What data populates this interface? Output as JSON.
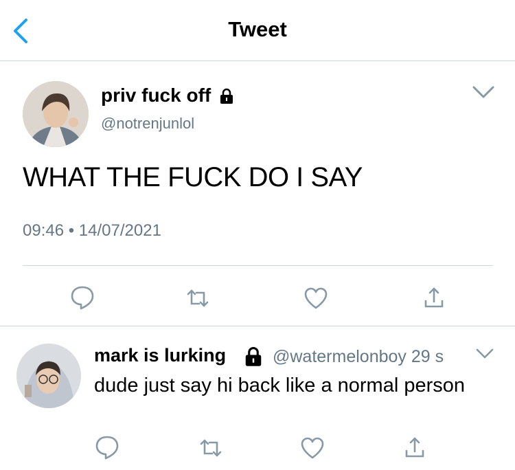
{
  "header": {
    "title": "Tweet",
    "back_icon": "chevron-left-icon",
    "accent": "#1da1f2"
  },
  "main_tweet": {
    "display_name": "priv fuck off",
    "handle": "@notrenjunlol",
    "protected_icon": "lock-icon",
    "text": "WHAT THE FUCK DO I SAY",
    "timestamp": "09:46 • 14/07/2021",
    "actions": [
      "reply-icon",
      "retweet-icon",
      "like-icon",
      "share-icon"
    ]
  },
  "reply": {
    "display_name": "mark is lurking",
    "handle": "@watermelonboy",
    "time": "29 s",
    "protected_icon": "lock-icon",
    "text": "dude just say hi back like a normal person",
    "actions": [
      "reply-icon",
      "retweet-icon",
      "like-icon",
      "share-icon"
    ]
  },
  "colors": {
    "secondary_text": "#657786",
    "icon_gray": "#8899a6",
    "divider": "#cfd6db"
  }
}
